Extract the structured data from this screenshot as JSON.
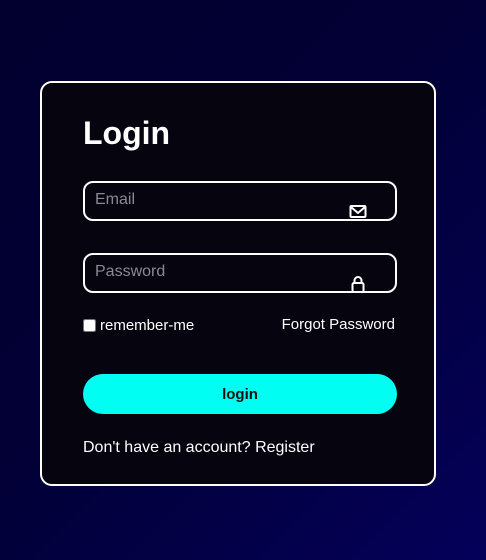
{
  "login_form": {
    "title": "Login",
    "email": {
      "value": "",
      "placeholder": "Email",
      "icon": "mail-icon"
    },
    "password": {
      "value": "",
      "placeholder": "Password",
      "icon": "lock-icon"
    },
    "remember_label": "remember-me",
    "remember_checked": false,
    "forgot_link": "Forgot Password",
    "submit_label": "login",
    "register_prompt": "Don't have an account?",
    "register_link": "Register"
  },
  "colors": {
    "background": "#02002e",
    "card": "#05040f",
    "accent": "#00fff2",
    "border": "#ffffff"
  }
}
